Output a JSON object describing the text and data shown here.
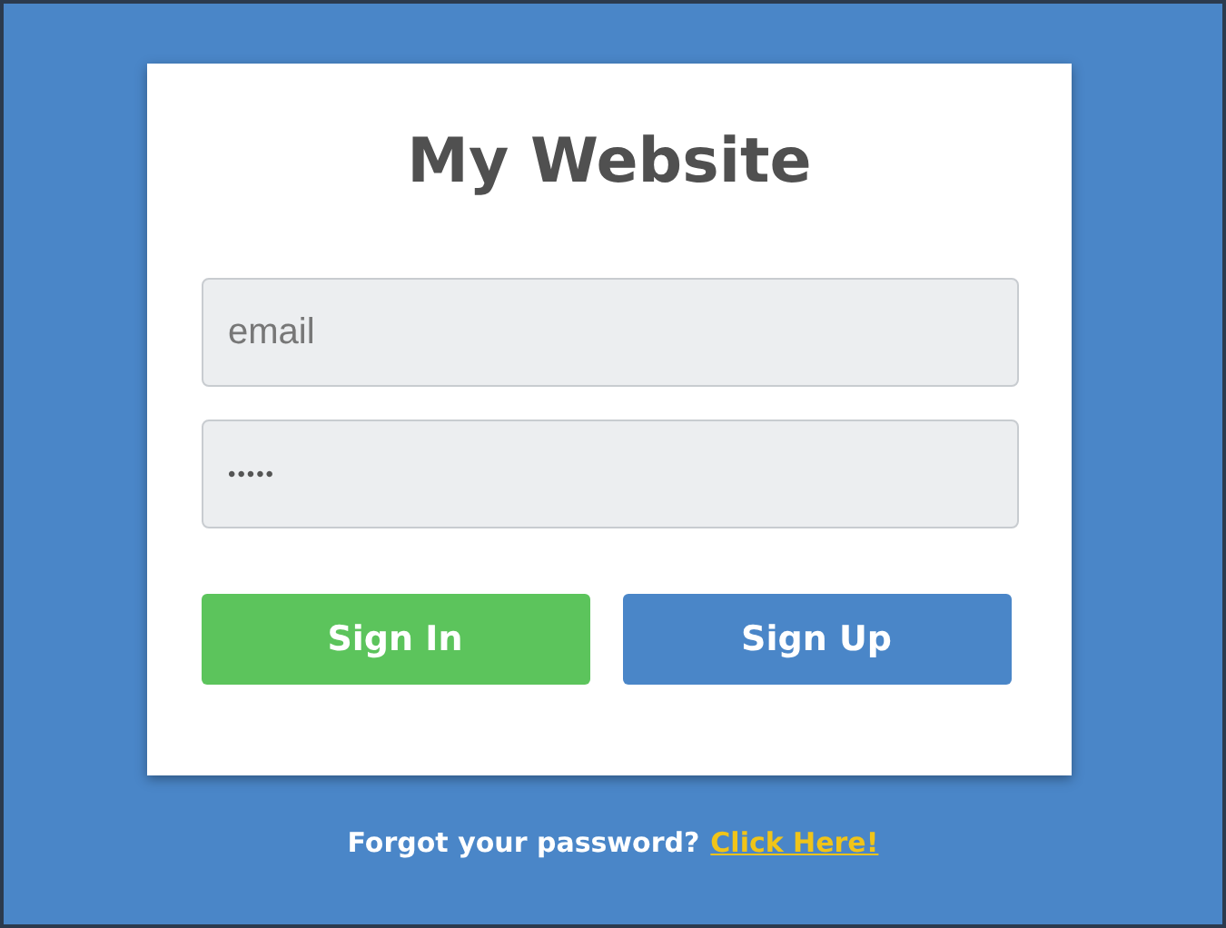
{
  "login_card": {
    "title": "My Website",
    "fields": [
      {
        "kind": "text",
        "placeholder": "email"
      },
      {
        "kind": "password",
        "value": "•••••"
      }
    ],
    "buttons": [
      {
        "label": "Sign In",
        "color": "#5cc45c"
      },
      {
        "label": "Sign Up",
        "color": "#4a86c8"
      }
    ]
  },
  "footer": {
    "text": "Forgot your password?",
    "link": "Click Here!"
  }
}
